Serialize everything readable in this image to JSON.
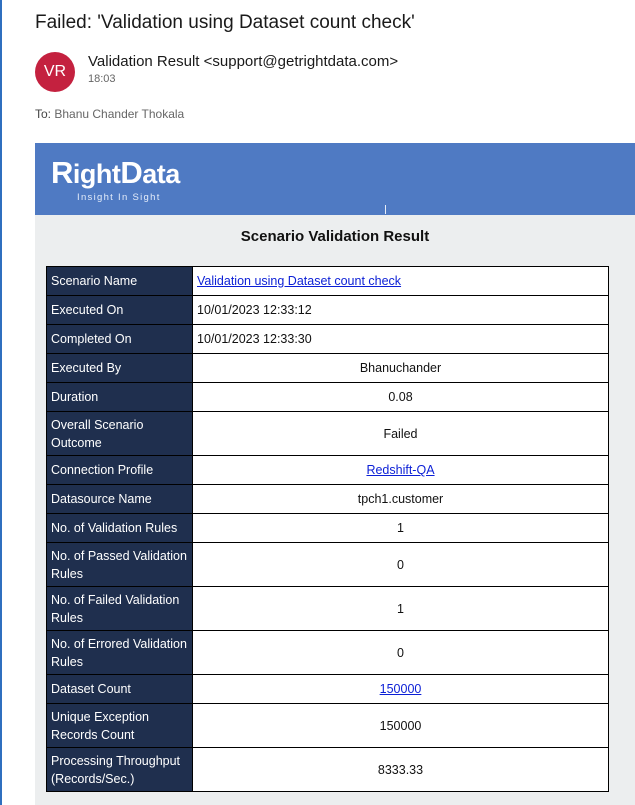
{
  "email": {
    "subject": "Failed: 'Validation using Dataset count check'",
    "avatar_initials": "VR",
    "avatar_color": "#c4213f",
    "sender": "Validation Result <support@getrightdata.com>",
    "time": "18:03",
    "to_label": "To:",
    "to_name": "Bhanu Chander Thokala"
  },
  "banner": {
    "logo_text_r": "R",
    "logo_text_ight": "ight",
    "logo_text_d": "D",
    "logo_text_ata": "ata",
    "tagline": "Insight In Sight",
    "color": "#4f7ac3"
  },
  "report": {
    "heading": "Scenario Validation Result",
    "rows": [
      {
        "label": "Scenario Name",
        "value": "Validation using Dataset count check"
      },
      {
        "label": "Executed On",
        "value": "10/01/2023 12:33:12"
      },
      {
        "label": "Completed On",
        "value": "10/01/2023 12:33:30"
      },
      {
        "label": "Executed By",
        "value": "Bhanuchander"
      },
      {
        "label": "Duration",
        "value": "0.08"
      },
      {
        "label": "Overall Scenario Outcome",
        "value": "Failed",
        "color": "#e51b1b"
      },
      {
        "label": "Connection Profile",
        "value": "Redshift-QA"
      },
      {
        "label": "Datasource Name",
        "value": "tpch1.customer"
      },
      {
        "label": "No. of Validation Rules",
        "value": "1"
      },
      {
        "label": "No. of Passed Validation Rules",
        "value": "0"
      },
      {
        "label": "No. of Failed Validation Rules",
        "value": "1"
      },
      {
        "label": "No. of Errored Validation Rules",
        "value": "0"
      },
      {
        "label": "Dataset Count",
        "value": "150000"
      },
      {
        "label": "Unique Exception Records Count",
        "value": "150000"
      },
      {
        "label": "Processing Throughput (Records/Sec.)",
        "value": "8333.33"
      }
    ]
  }
}
